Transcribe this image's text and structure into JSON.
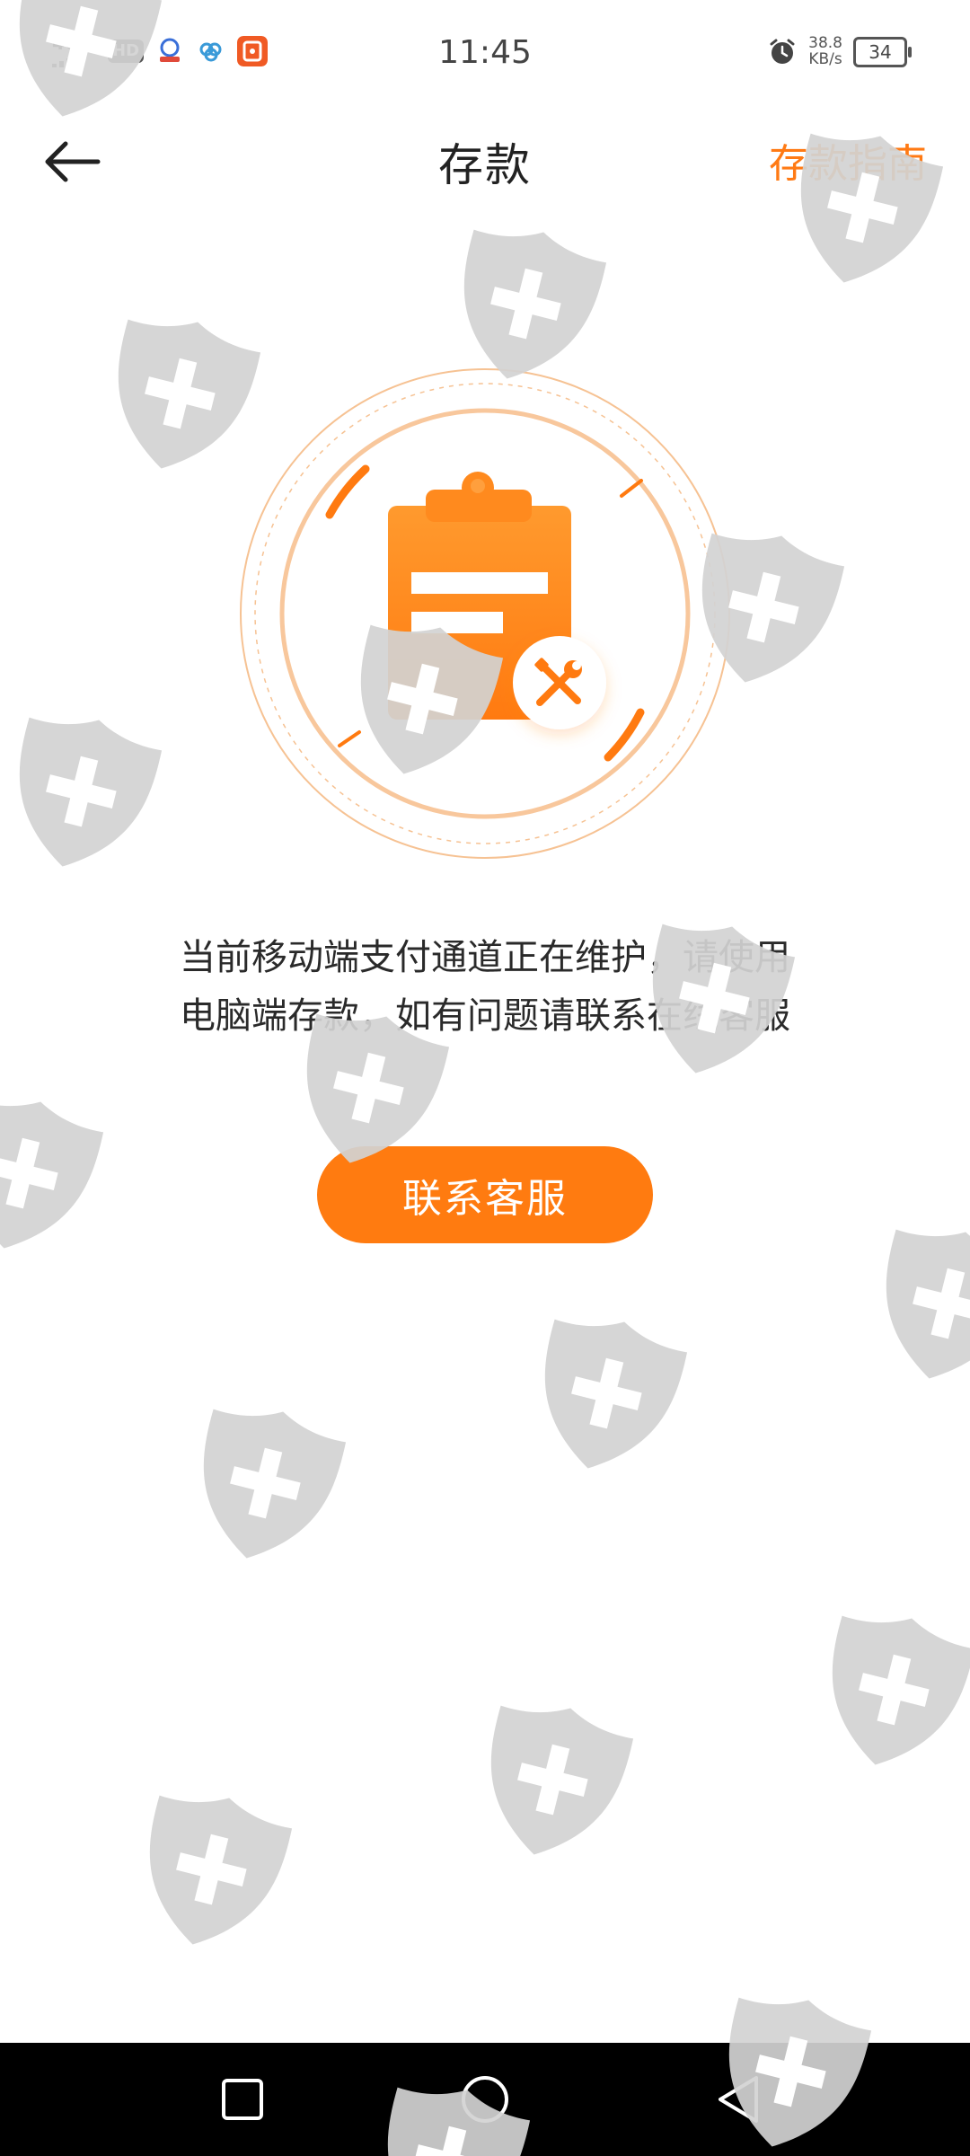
{
  "status_bar": {
    "network": "4G+",
    "hd_badge": "HD",
    "time": "11:45",
    "net_speed_value": "38.8",
    "net_speed_unit": "KB/s",
    "battery": "34"
  },
  "header": {
    "title": "存款",
    "guide_label": "存款指南"
  },
  "main": {
    "message_line1": "当前移动端支付通道正在维护，请使用",
    "message_line2": "电脑端存款，如有问题请联系在线客服",
    "contact_button_label": "联系客服"
  },
  "colors": {
    "accent": "#ff7b10",
    "illustration_orange": "#ff8a1e",
    "ring_light": "#f6c293",
    "watermark_gray": "#d6d6d6",
    "nav_bar": "#000000"
  },
  "icons": {
    "back": "arrow-left-icon",
    "illustration": "clipboard-maintenance-icon",
    "tool": "wrench-screwdriver-icon",
    "nav_recent": "square-icon",
    "nav_home": "circle-icon",
    "nav_back": "triangle-back-icon"
  }
}
